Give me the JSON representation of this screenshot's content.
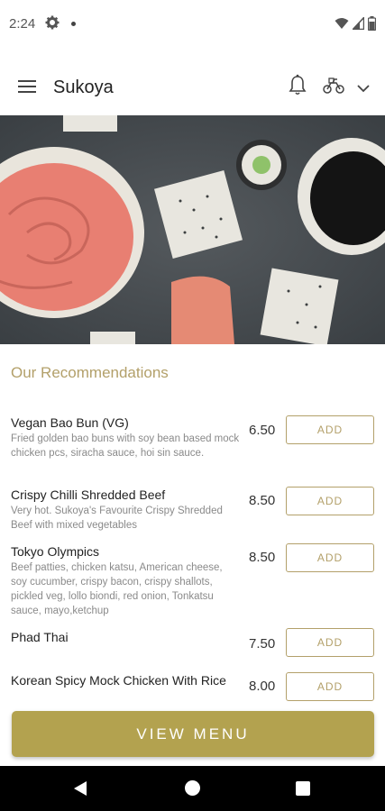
{
  "status": {
    "time": "2:24"
  },
  "app": {
    "title": "Sukoya"
  },
  "section": {
    "title": "Our Recommendations"
  },
  "items": [
    {
      "name": "Vegan Bao Bun (VG)",
      "desc": "Fried golden bao buns with soy bean based mock chicken pcs, siracha sauce, hoi sin sauce.",
      "price": "6.50",
      "add_label": "ADD"
    },
    {
      "name": "Crispy Chilli Shredded Beef",
      "desc": "Very hot. Sukoya's Favourite Crispy Shredded Beef with mixed vegetables",
      "price": "8.50",
      "add_label": "ADD"
    },
    {
      "name": "Tokyo Olympics",
      "desc": "Beef patties, chicken katsu, American cheese, soy cucumber, crispy bacon, crispy shallots, pickled veg, lollo biondi, red onion, Tonkatsu sauce, mayo,ketchup",
      "price": "8.50",
      "add_label": "ADD"
    },
    {
      "name": "Phad Thai",
      "desc": "",
      "price": "7.50",
      "add_label": "ADD"
    },
    {
      "name": "Korean Spicy Mock Chicken With Rice",
      "desc": "",
      "price": "8.00",
      "add_label": "ADD"
    }
  ],
  "view_menu_label": "VIEW MENU",
  "colors": {
    "accent": "#b3a06a",
    "button": "#b3a24f"
  },
  "icons": [
    "settings-icon",
    "wifi-icon",
    "signal-icon",
    "battery-icon",
    "menu-icon",
    "bell-icon",
    "delivery-bike-icon",
    "chevron-down-icon",
    "back-icon",
    "home-icon",
    "recent-apps-icon"
  ]
}
